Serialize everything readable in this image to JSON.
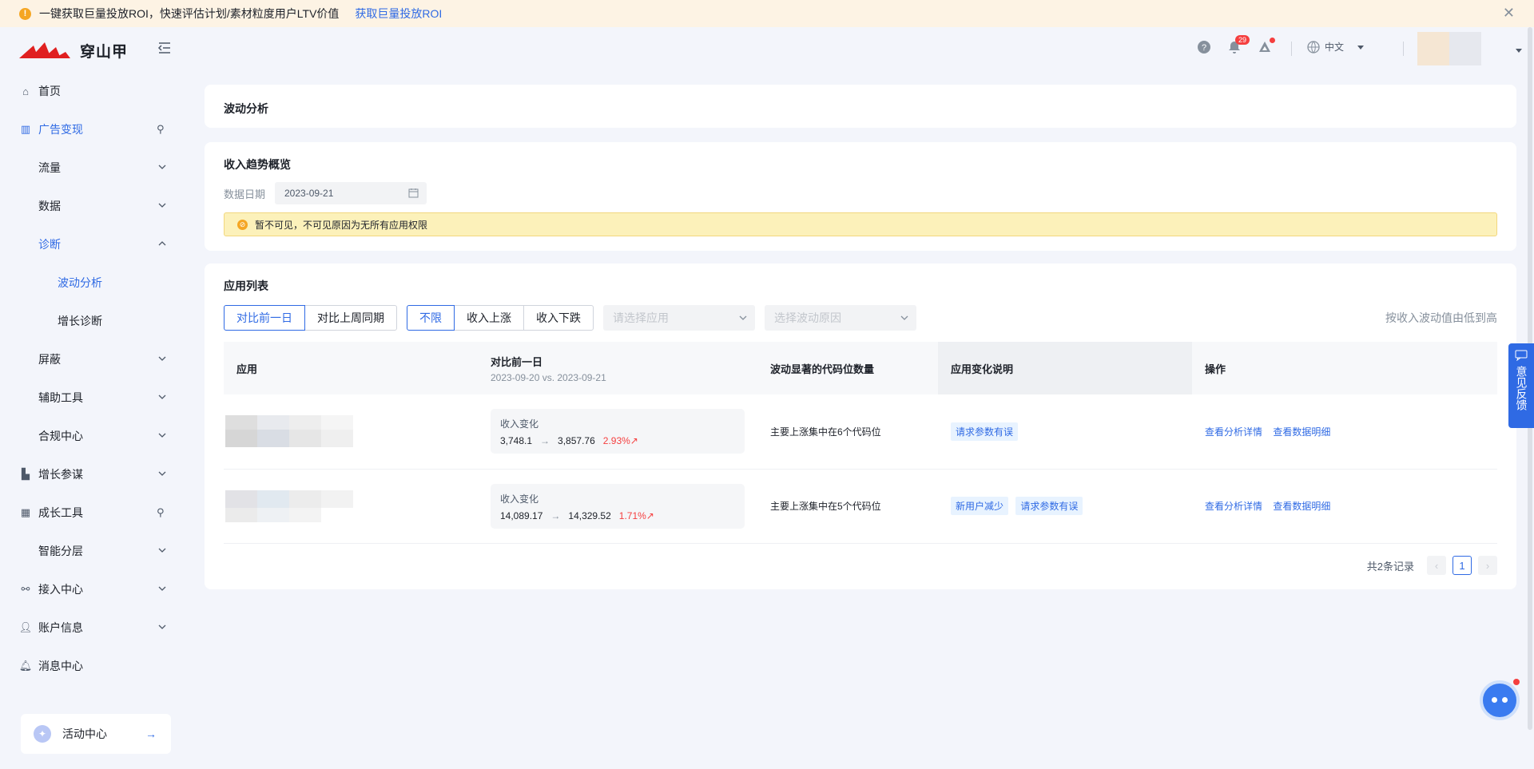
{
  "banner": {
    "text": "一键获取巨量投放ROI，快速评估计划/素材粒度用户LTV价值",
    "link": "获取巨量投放ROI"
  },
  "logo": {
    "text": "穿山甲"
  },
  "sidebar": {
    "items": [
      {
        "label": "首页",
        "icon": "home-icon"
      },
      {
        "label": "广告变现",
        "icon": "chart-icon"
      },
      {
        "label": "流量"
      },
      {
        "label": "数据"
      },
      {
        "label": "诊断"
      },
      {
        "label": "波动分析"
      },
      {
        "label": "增长诊断"
      },
      {
        "label": "屏蔽"
      },
      {
        "label": "辅助工具"
      },
      {
        "label": "合规中心"
      },
      {
        "label": "增长参谋",
        "icon": "growth-icon"
      },
      {
        "label": "成长工具",
        "icon": "grid-icon"
      },
      {
        "label": "智能分层"
      },
      {
        "label": "接入中心",
        "icon": "plug-icon"
      },
      {
        "label": "账户信息",
        "icon": "user-icon"
      },
      {
        "label": "消息中心",
        "icon": "bell-icon"
      }
    ],
    "activity": "活动中心"
  },
  "header": {
    "notifications": "29",
    "language": "中文"
  },
  "page": {
    "title": "波动分析"
  },
  "overview": {
    "title": "收入趋势概览",
    "date_label": "数据日期",
    "date_value": "2023-09-21",
    "notice": "暂不可见，不可见原因为无所有应用权限"
  },
  "app_list": {
    "title": "应用列表",
    "compare_tabs": [
      "对比前一日",
      "对比上周同期"
    ],
    "filter_tabs": [
      "不限",
      "收入上涨",
      "收入下跌"
    ],
    "select_app_placeholder": "请选择应用",
    "select_reason_placeholder": "选择波动原因",
    "sort_label": "按收入波动值由低到高",
    "columns": {
      "app": "应用",
      "compare": "对比前一日",
      "compare_range": "2023-09-20 vs. 2023-09-21",
      "count": "波动显著的代码位数量",
      "desc": "应用变化说明",
      "ops": "操作"
    },
    "rows": [
      {
        "rev_label": "收入变化",
        "from": "3,748.1",
        "to": "3,857.76",
        "pct": "2.93%↗",
        "count_text": "主要上涨集中在6个代码位",
        "tags": [
          "请求参数有误"
        ],
        "ops": [
          "查看分析详情",
          "查看数据明细"
        ]
      },
      {
        "rev_label": "收入变化",
        "from": "14,089.17",
        "to": "14,329.52",
        "pct": "1.71%↗",
        "count_text": "主要上涨集中在5个代码位",
        "tags": [
          "新用户减少",
          "请求参数有误"
        ],
        "ops": [
          "查看分析详情",
          "查看数据明细"
        ]
      }
    ],
    "total": "共2条记录",
    "current_page": "1"
  },
  "feedback": "意见反馈"
}
